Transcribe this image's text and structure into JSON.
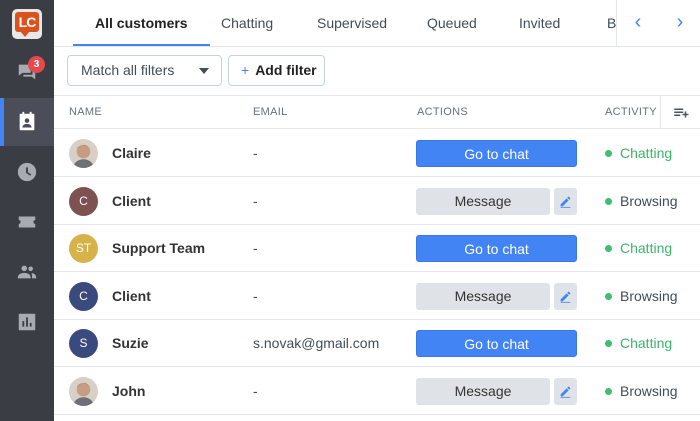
{
  "logo": {
    "text": "LC"
  },
  "sidebar": {
    "items": [
      {
        "name": "chats",
        "icon": "chat-bubbles-icon",
        "badge": "3"
      },
      {
        "name": "customers",
        "icon": "contact-card-icon",
        "active": true
      },
      {
        "name": "archives",
        "icon": "clock-icon"
      },
      {
        "name": "tickets",
        "icon": "ticket-icon"
      },
      {
        "name": "team",
        "icon": "people-icon"
      },
      {
        "name": "reports",
        "icon": "bar-chart-icon"
      }
    ]
  },
  "tabs": [
    {
      "label": "All customers",
      "active": true
    },
    {
      "label": "Chatting"
    },
    {
      "label": "Supervised"
    },
    {
      "label": "Queued"
    },
    {
      "label": "Invited"
    },
    {
      "label": "B"
    }
  ],
  "tab_nav": {
    "prev": "‹",
    "next": "›"
  },
  "filters": {
    "match_select": "Match all filters",
    "add_filter_label": "Add filter",
    "add_filter_icon": "+"
  },
  "table": {
    "headers": {
      "name": "NAME",
      "email": "EMAIL",
      "actions": "ACTIONS",
      "activity": "ACTIVITY"
    },
    "rows": [
      {
        "name": "Claire",
        "email": "-",
        "action": "Go to chat",
        "action_type": "chat",
        "activity": "Chatting",
        "avatar": "photo",
        "initials": ""
      },
      {
        "name": "Client",
        "email": "-",
        "action": "Message",
        "action_type": "message",
        "activity": "Browsing",
        "avatar": "initials",
        "initials": "C",
        "avatar_color": "#7e5252"
      },
      {
        "name": "Support Team",
        "email": "-",
        "action": "Go to chat",
        "action_type": "chat",
        "activity": "Chatting",
        "avatar": "initials",
        "initials": "ST",
        "avatar_color": "#d7b24a"
      },
      {
        "name": "Client",
        "email": "-",
        "action": "Message",
        "action_type": "message",
        "activity": "Browsing",
        "avatar": "initials",
        "initials": "C",
        "avatar_color": "#3a4a7c"
      },
      {
        "name": "Suzie",
        "email": "s.novak@gmail.com",
        "action": "Go to chat",
        "action_type": "chat",
        "activity": "Chatting",
        "avatar": "initials",
        "initials": "S",
        "avatar_color": "#3a4a7c"
      },
      {
        "name": "John",
        "email": "-",
        "action": "Message",
        "action_type": "message",
        "activity": "Browsing",
        "avatar": "photo",
        "initials": ""
      }
    ]
  },
  "colors": {
    "accent": "#4384f5",
    "chatting": "#3bb56a",
    "sidebar": "#3b3d45"
  }
}
